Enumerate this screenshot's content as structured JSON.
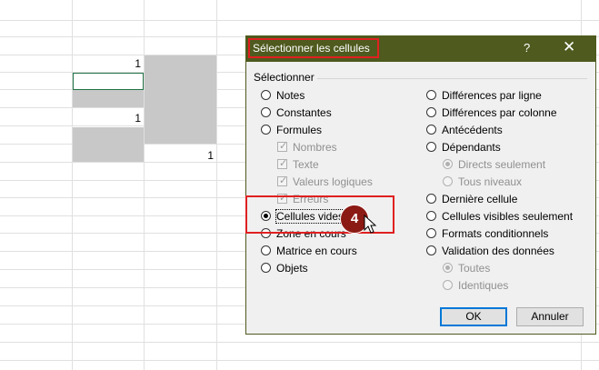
{
  "spreadsheet": {
    "values": [
      "1",
      "1",
      "1"
    ]
  },
  "dialog": {
    "title": "Sélectionner les cellules",
    "help": "?",
    "close": "✕",
    "group_label": "Sélectionner",
    "left_options": [
      {
        "label": "Notes",
        "selected": false
      },
      {
        "label": "Constantes",
        "selected": false
      },
      {
        "label": "Formules",
        "selected": false
      },
      {
        "label": "Cellules vides",
        "selected": true
      },
      {
        "label": "Zone en cours",
        "selected": false
      },
      {
        "label": "Matrice en cours",
        "selected": false
      },
      {
        "label": "Objets",
        "selected": false
      }
    ],
    "formula_checks": [
      {
        "label": "Nombres",
        "checked": true
      },
      {
        "label": "Texte",
        "checked": true
      },
      {
        "label": "Valeurs logiques",
        "checked": true
      },
      {
        "label": "Erreurs",
        "checked": true
      }
    ],
    "right_options": [
      {
        "label": "Différences par ligne",
        "selected": false
      },
      {
        "label": "Différences par colonne",
        "selected": false
      },
      {
        "label": "Antécédents",
        "selected": false
      },
      {
        "label": "Dépendants",
        "selected": false
      },
      {
        "label": "Dernière cellule",
        "selected": false
      },
      {
        "label": "Cellules visibles seulement",
        "selected": false
      },
      {
        "label": "Formats conditionnels",
        "selected": false
      },
      {
        "label": "Validation des données",
        "selected": false
      }
    ],
    "dependants_sub": [
      {
        "label": "Directs seulement",
        "selected": true
      },
      {
        "label": "Tous niveaux",
        "selected": false
      }
    ],
    "validation_sub": [
      {
        "label": "Toutes",
        "selected": true
      },
      {
        "label": "Identiques",
        "selected": false
      }
    ],
    "ok_label": "OK",
    "cancel_label": "Annuler"
  },
  "annotation": {
    "step": "4",
    "accent_color": "#e02020",
    "badge_color": "#8b1a14",
    "title_bar_color": "#4e5a1e"
  }
}
